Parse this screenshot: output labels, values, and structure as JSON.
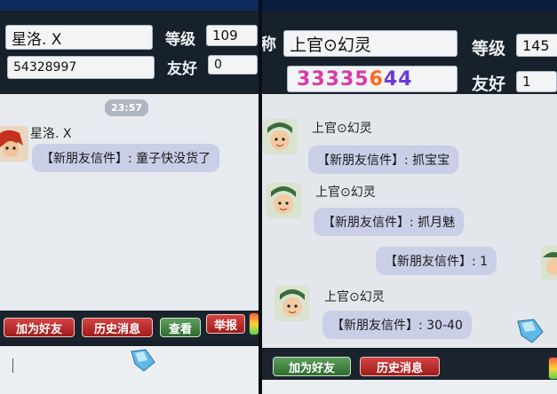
{
  "left": {
    "nickname": "星洛. X",
    "id_number": "54328997",
    "level_label": "等级",
    "level_value": "109",
    "friendship_label": "友好",
    "friendship_value": "0",
    "timestamp": "23:57",
    "sender_name": "星洛. X",
    "message": "【新朋友信件】: 童子快没货了",
    "buttons": {
      "add_friend": "加为好友",
      "history": "历史消息",
      "view": "查看",
      "report": "举报"
    }
  },
  "right": {
    "name_label_partial": "称",
    "nickname": "上官⊙幻灵",
    "id_number": "33335644",
    "level_label": "等级",
    "level_value": "145",
    "friendship_label": "友好",
    "friendship_value": "1",
    "messages": [
      {
        "sender": "上官⊙幻灵",
        "text": "【新朋友信件】: 抓宝宝"
      },
      {
        "sender": "上官⊙幻灵",
        "text": "【新朋友信件】: 抓月魅"
      },
      {
        "sender": "",
        "text": "【新朋友信件】: 1"
      },
      {
        "sender": "上官⊙幻灵",
        "text": "【新朋友信件】: 30-40"
      }
    ],
    "buttons": {
      "add_friend": "加为好友",
      "history": "历史消息"
    }
  },
  "colors": {
    "accent_red": "#c22a2a",
    "bubble": "#c9cfe7",
    "lucky_digit_pink": "#d83aa8",
    "lucky_digit_orange": "#ff6a1a",
    "lucky_digit_purple": "#6a3ad8"
  },
  "icons": [
    "crystal-icon",
    "status-light-icon",
    "avatar-icon"
  ]
}
